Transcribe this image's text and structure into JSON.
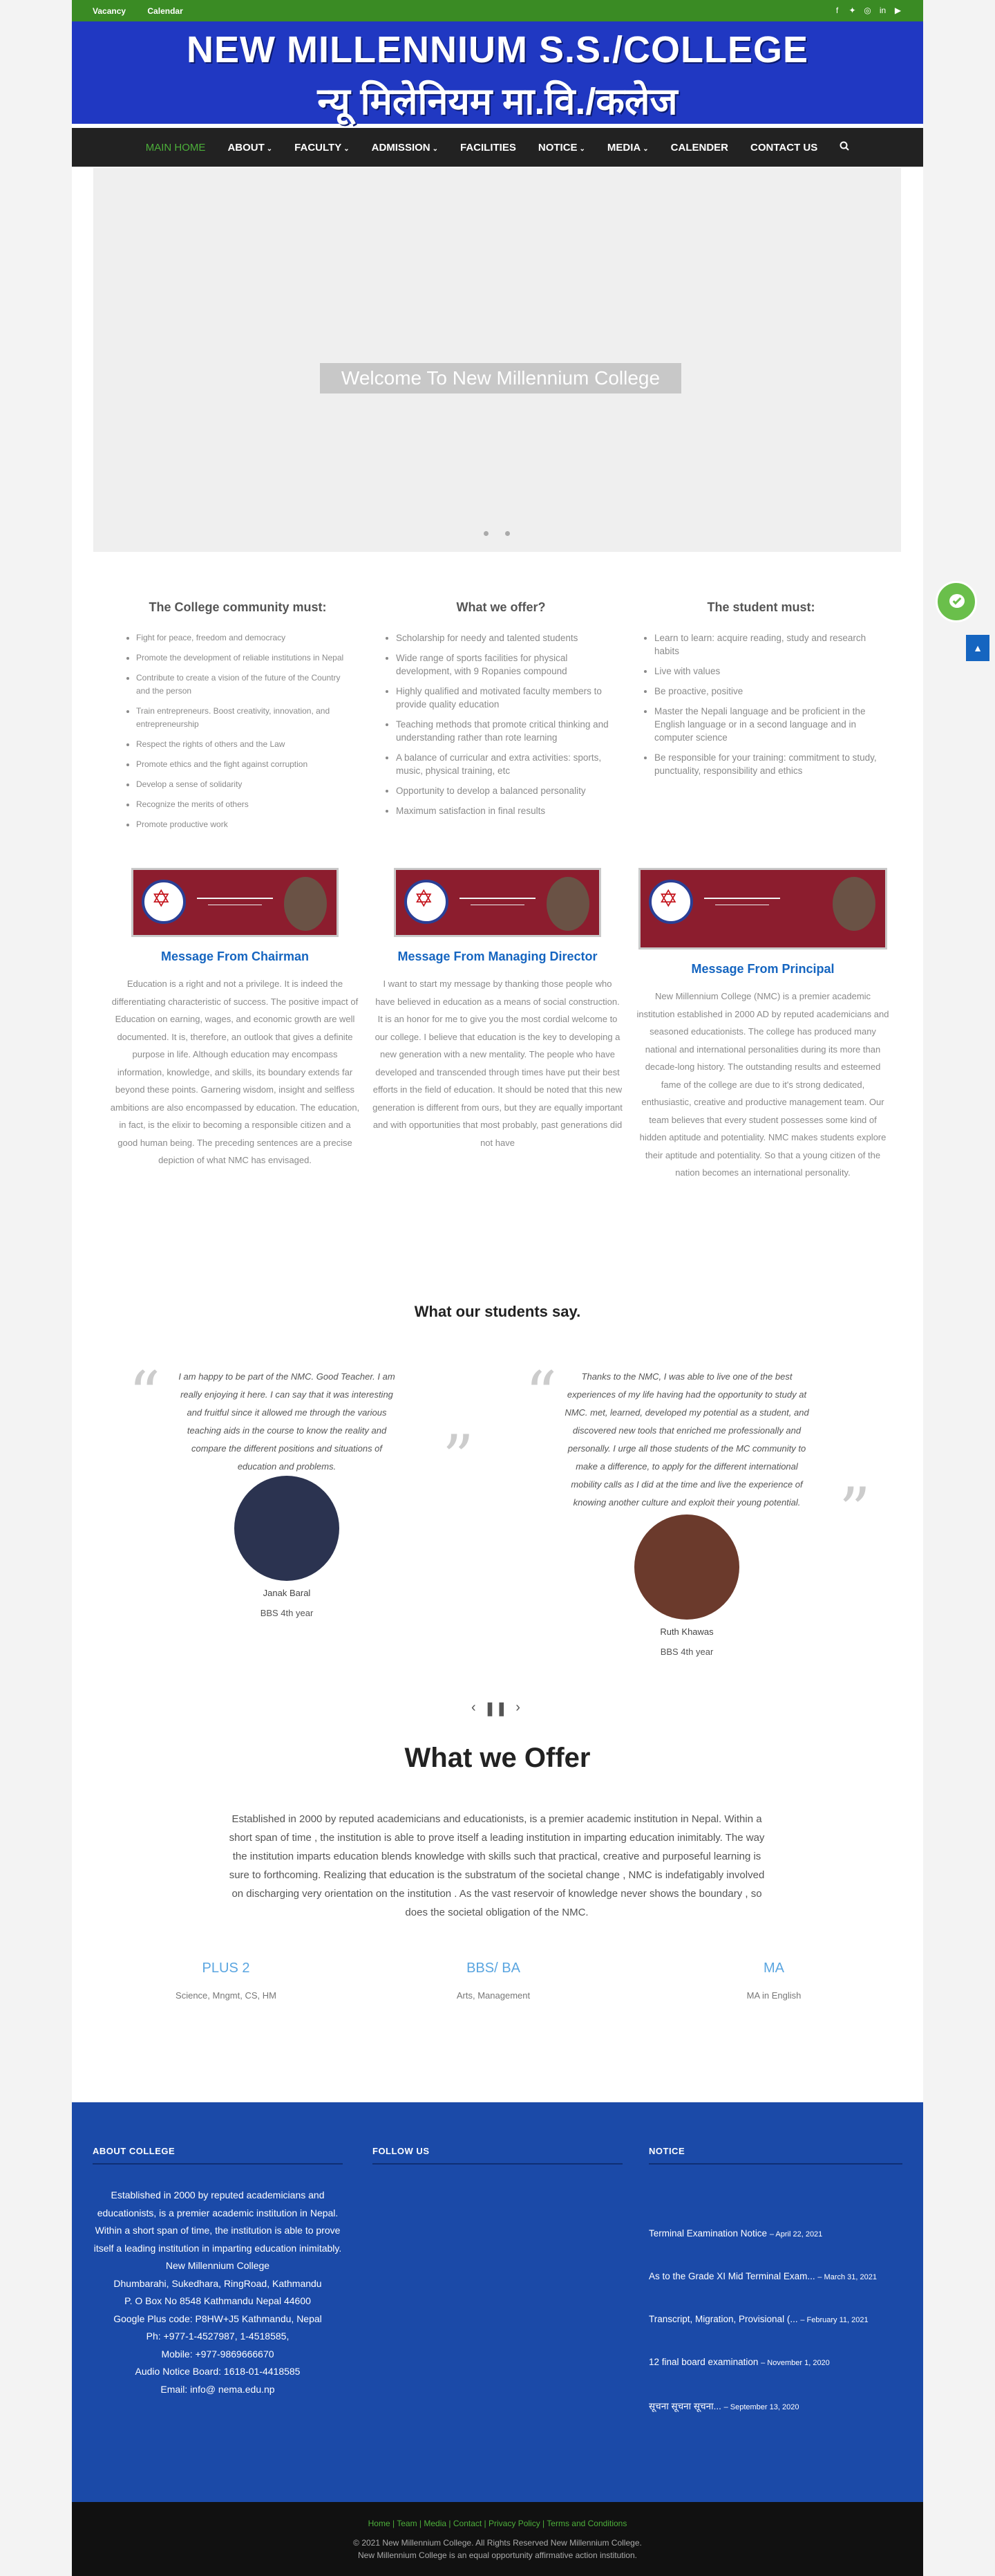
{
  "topbar": {
    "links": [
      "Vacancy",
      "Calendar"
    ],
    "social_icons": [
      "facebook-icon",
      "twitter-icon",
      "instagram-icon",
      "linkedin-icon",
      "youtube-icon"
    ]
  },
  "banner": {
    "title_en": "NEW MILLENNIUM S.S./COLLEGE",
    "title_np": "न्यू मिलेनियम मा.वि./कलेज"
  },
  "nav": {
    "items": [
      {
        "label": "MAIN HOME",
        "caret": ""
      },
      {
        "label": "ABOUT",
        "caret": "⌄"
      },
      {
        "label": "FACULTY",
        "caret": "⌄"
      },
      {
        "label": "ADMISSION",
        "caret": "⌄"
      },
      {
        "label": "FACILITIES",
        "caret": ""
      },
      {
        "label": "NOTICE",
        "caret": "⌄"
      },
      {
        "label": "MEDIA",
        "caret": "⌄"
      },
      {
        "label": "CALENDER",
        "caret": ""
      },
      {
        "label": "CONTACT US",
        "caret": ""
      }
    ]
  },
  "slider": {
    "welcome": "Welcome To New Millennium College"
  },
  "community": {
    "title": "The College community must:",
    "items": [
      "Fight for peace, freedom and democracy",
      "Promote the development of reliable institutions in Nepal",
      "Contribute to create a vision of the future of the Country and the person",
      "Train entrepreneurs. Boost creativity, innovation, and entrepreneurship",
      "Respect the rights of others and the Law",
      "Promote ethics and the fight against corruption",
      "Develop a sense of solidarity",
      "Recognize the merits of others",
      "Promote productive work"
    ]
  },
  "offer_list": {
    "title": "What we offer?",
    "items": [
      "Scholarship for needy and talented students",
      "Wide range of sports facilities for physical development, with 9 Ropanies compound",
      "Highly qualified and motivated faculty members to provide quality education",
      "Teaching methods that promote critical thinking and understanding rather than rote learning",
      "A balance of curricular and extra activities: sports, music, physical training, etc",
      "Opportunity to develop a balanced personality",
      "Maximum satisfaction in final results"
    ]
  },
  "student": {
    "title": "The student must:",
    "items": [
      "Learn to learn: acquire reading, study and research habits",
      "Live with values",
      "Be proactive, positive",
      "Master the Nepali language and be proficient in the English language or in a second language and in computer science",
      "Be responsible for your training: commitment to study, punctuality, responsibility and ethics"
    ]
  },
  "messages": [
    {
      "title": "Message From Chairman",
      "text": "Education is a right and not a privilege. It is indeed the differentiating characteristic of success. The positive impact of Education on earning, wages, and economic growth are well documented. It is, therefore, an outlook that gives a definite purpose in life. Although education may encompass information, knowledge, and skills, its boundary extends far beyond these points. Garnering wisdom, insight and selfless ambitions are also encompassed by education. The education, in fact, is the elixir to becoming a responsible citizen and a good human being. The preceding sentences are a precise depiction of what NMC has envisaged."
    },
    {
      "title": "Message From Managing Director",
      "text": "I want to start my message by thanking those people who have believed in education as a means of social construction. It is an honor for me to give you the most cordial welcome to our college. I believe that education is the key to developing a new generation with a new mentality. The people who have developed and transcended through times have put their best efforts in the field of education. It should be noted that this new generation is different from ours, but they are equally important and with opportunities that most probably, past generations did not have"
    },
    {
      "title": "Message From Principal",
      "text": "New Millennium College (NMC) is a premier academic institution established in 2000 AD by reputed academicians and seasoned educationists. The college has produced many national and international personalities during its more than decade-long history. The outstanding results and esteemed fame of the college are due to it's strong dedicated, enthusiastic, creative and productive management team. Our team believes that every student possesses some kind of hidden aptitude and potentiality. NMC makes students explore their aptitude and potentiality. So that a young citizen of the nation becomes an international personality."
    }
  ],
  "testimonials": {
    "title": "What our students say.",
    "items": [
      {
        "text": "I am happy to be part of the NMC. Good Teacher. I am really enjoying it here. I can say that it was interesting and fruitful since it allowed me through the various teaching aids in the course to know the reality and compare the different positions and situations of education and problems.",
        "name": "Janak Baral",
        "year": "BBS 4th year"
      },
      {
        "text": "Thanks to the NMC, I was able to live one of the best experiences of my life having had the opportunity to study at NMC. met, learned, developed my potential as a student, and discovered new tools that enriched me professionally and personally. I urge all those students of the MC community to make a difference, to apply for the different international mobility calls as I did at the time and live the experience of knowing another culture and exploit their young potential.",
        "name": "Ruth Khawas",
        "year": "BBS 4th year"
      }
    ]
  },
  "what_offer": {
    "title": "What we Offer",
    "text": "Established in 2000 by reputed academicians and educationists, is a premier academic institution in Nepal. Within a short span of time , the institution is able to prove itself a leading institution in imparting education inimitably. The way the institution imparts education blends knowledge with skills such that practical, creative and purposeful learning is sure to forthcoming. Realizing that education is the substratum of the societal change , NMC is indefatigably involved on discharging very orientation on the institution . As the vast reservoir of knowledge never shows the boundary , so does the societal obligation of the NMC.",
    "programs": [
      {
        "title": "PLUS 2",
        "sub": "Science, Mngmt, CS, HM"
      },
      {
        "title": "BBS/ BA",
        "sub": "Arts, Management"
      },
      {
        "title": "MA",
        "sub": "MA in English"
      }
    ]
  },
  "footer": {
    "about_title": "ABOUT COLLEGE",
    "follow_title": "FOLLOW US",
    "notice_title": "NOTICE",
    "about_lines": [
      "Established in 2000 by reputed academicians and educationists, is a premier academic institution in Nepal. Within a short span of time, the institution is able to prove itself a leading institution in imparting education inimitably.",
      "New Millennium College",
      "Dhumbarahi, Sukedhara, RingRoad, Kathmandu",
      "P. O Box No 8548 Kathmandu Nepal 44600",
      "Google Plus code: P8HW+J5 Kathmandu, Nepal",
      "Ph: +977-1-4527987, 1-4518585,",
      "Mobile: +977-9869666670",
      "Audio Notice Board: 1618-01-4418585",
      "Email: info@ nema.edu.np"
    ],
    "notices": [
      {
        "title": "Terminal Examination Notice",
        "date": "– April 22, 2021"
      },
      {
        "title": "As to the Grade XI Mid Terminal Exam...",
        "date": "– March 31, 2021"
      },
      {
        "title": "Transcript, Migration, Provisional (...",
        "date": "– February 11, 2021"
      },
      {
        "title": "12 final board examination",
        "date": "– November 1, 2020"
      },
      {
        "title": "सूचना सूचना सूचना...",
        "date": "– September 13, 2020"
      }
    ]
  },
  "bottom": {
    "links": [
      "Home",
      "Team",
      "Media",
      "Contact",
      "Privacy Policy",
      "Terms and Conditions"
    ],
    "copyright": "© 2021 New Millennium College. All Rights Reserved New Millennium College.",
    "equal": "New Millennium College is an equal opportunity affirmative action institution."
  }
}
